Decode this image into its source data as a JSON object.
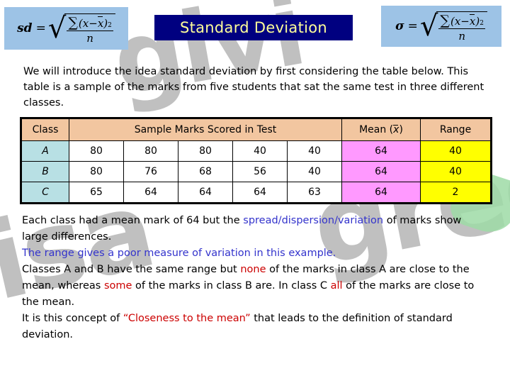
{
  "slide": {
    "title": "Standard Deviation",
    "title_colors": {
      "background": "#000080",
      "text": "#ffff99"
    }
  },
  "formulas": {
    "left": {
      "lhs": "sd",
      "equals": "=",
      "sum_symbol": "∑",
      "numerator_open": "(",
      "numerator_x": "x",
      "numerator_minus": "−",
      "numerator_xbar": "x",
      "numerator_close": ")",
      "numerator_power": "2",
      "denominator": "n",
      "background": "#9dc3e6"
    },
    "right": {
      "lhs": "σ",
      "equals": "=",
      "sum_symbol": "∑",
      "numerator_open": "(",
      "numerator_x": "x",
      "numerator_minus": "−",
      "numerator_xbar": "x",
      "numerator_close": ")",
      "numerator_power": "2",
      "denominator": "n",
      "background": "#9dc3e6"
    }
  },
  "intro": {
    "text": "We will introduce the idea standard deviation by first considering the table below. This table is a sample of the marks from five students that sat the same test in three different classes."
  },
  "table": {
    "headers": {
      "class": "Class",
      "sample_marks": "Sample Marks Scored in Test",
      "mean_prefix": "Mean (",
      "mean_symbol": "x",
      "mean_suffix": ")",
      "range": "Range"
    },
    "colors": {
      "header": "#f2c6a0",
      "class_cell": "#b8e0e4",
      "mark_cell": "#ffffff",
      "mean_cell": "#ff99ff",
      "range_cell": "#ffff00",
      "border": "#000000"
    },
    "rows": [
      {
        "class": "A",
        "marks": [
          "80",
          "80",
          "80",
          "40",
          "40"
        ],
        "mean": "64",
        "range": "40"
      },
      {
        "class": "B",
        "marks": [
          "80",
          "76",
          "68",
          "56",
          "40"
        ],
        "mean": "64",
        "range": "40"
      },
      {
        "class": "C",
        "marks": [
          "65",
          "64",
          "64",
          "64",
          "63"
        ],
        "mean": "64",
        "range": "2"
      }
    ]
  },
  "notes": {
    "p1_a": "Each class had a mean mark of 64 but the ",
    "p1_hl": "spread/dispersion/variation",
    "p1_b": " of marks show large differences.",
    "p2": "The range gives a poor measure of variation in this example.",
    "p3_a": "Classes A and B have the same range but ",
    "p3_hl1": "none",
    "p3_b": " of the marks in class A are close to the mean, whereas ",
    "p3_hl2": "some",
    "p3_c": " of the marks in class B are. In class C ",
    "p3_hl3": "all",
    "p3_d": " of the marks are close to the mean.",
    "p4_a": "It is this concept of ",
    "p4_hl": "“Closeness to the mean”",
    "p4_b": " that leads to the definition of standard deviation.",
    "highlight_blue": "#3333cc",
    "highlight_red": "#cc0000"
  },
  "watermark": {
    "word_1": "givi",
    "word_2": "isa",
    "word_3": "gree",
    "color": "#c0c0c0"
  }
}
